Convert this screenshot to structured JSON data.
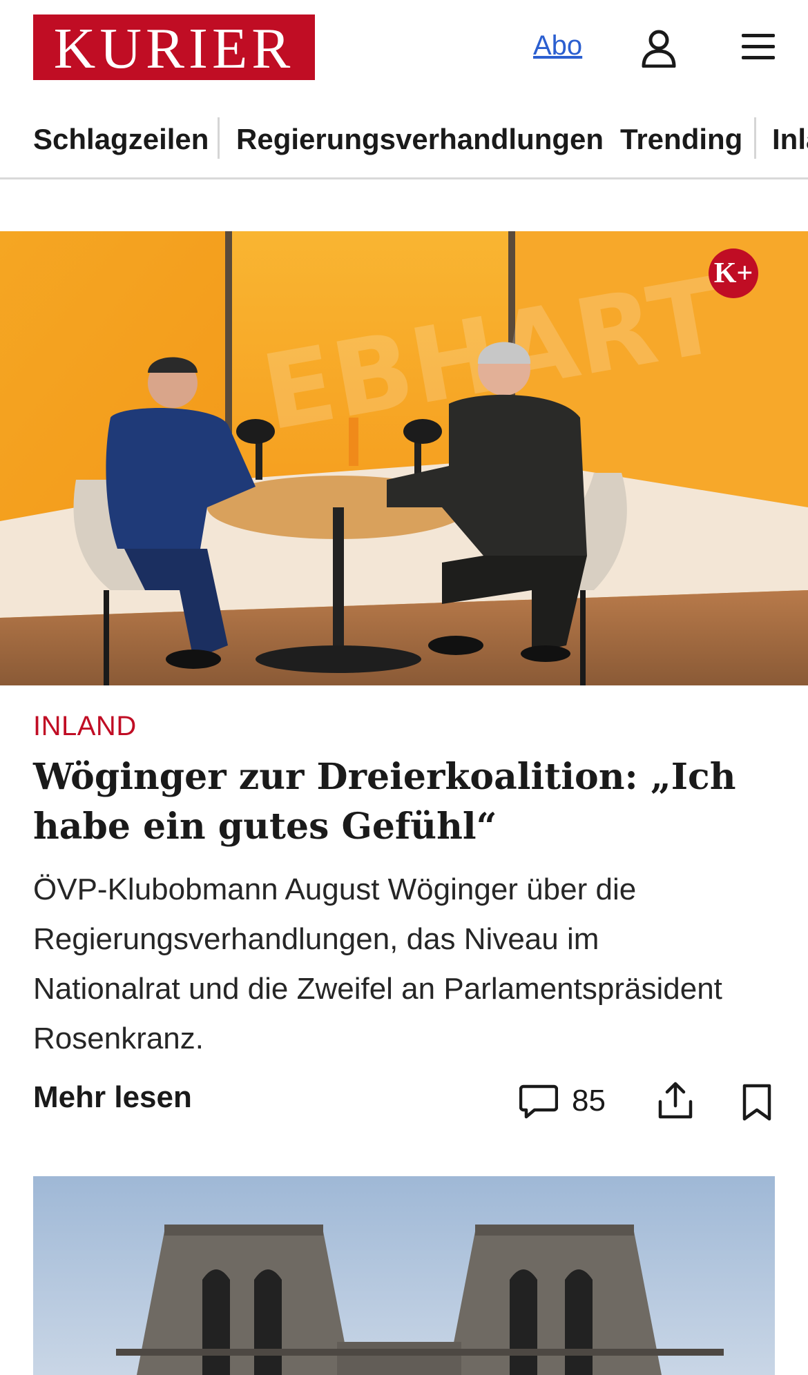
{
  "header": {
    "logo_text": "KURIER",
    "abo_label": "Abo",
    "icons": [
      "user-icon",
      "menu-icon"
    ],
    "colors": {
      "brand": "#c00d24",
      "link": "#2b5fd0"
    }
  },
  "nav": {
    "items": [
      {
        "label": "Schlagzeilen"
      },
      {
        "label": "Regierungsverhandlungen"
      },
      {
        "label": "Trending"
      },
      {
        "label": "Inland"
      }
    ]
  },
  "article": {
    "badge": "K+",
    "kicker": "INLAND",
    "headline": "Wöginger zur Dreierkoalition: „Ich habe ein gutes Gefühl“",
    "teaser": "ÖVP-Klubobmann August Wöginger über die Regierungsverhandlungen, das Niveau im Nationalrat und die Zweifel an Parlamentspräsident Rosenkranz.",
    "more_label": "Mehr lesen",
    "comment_count": "85",
    "icons": [
      "comment-icon",
      "share-icon",
      "bookmark-icon"
    ]
  }
}
